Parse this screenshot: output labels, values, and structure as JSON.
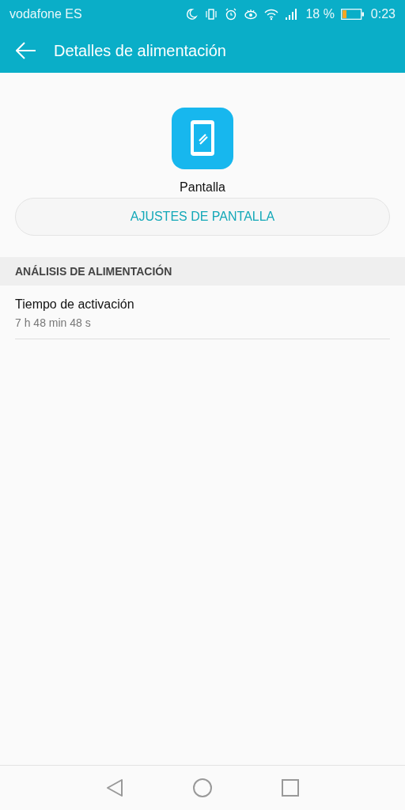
{
  "status_bar": {
    "carrier": "vodafone ES",
    "battery_text": "18 %",
    "time": "0:23"
  },
  "app_bar": {
    "title": "Detalles de alimentación"
  },
  "app": {
    "name": "Pantalla",
    "button": "AJUSTES DE PANTALLA"
  },
  "section": {
    "title": "ANÁLISIS DE ALIMENTACIÓN"
  },
  "items": [
    {
      "title": "Tiempo de activación",
      "subtitle": "7 h 48 min 48 s"
    }
  ]
}
